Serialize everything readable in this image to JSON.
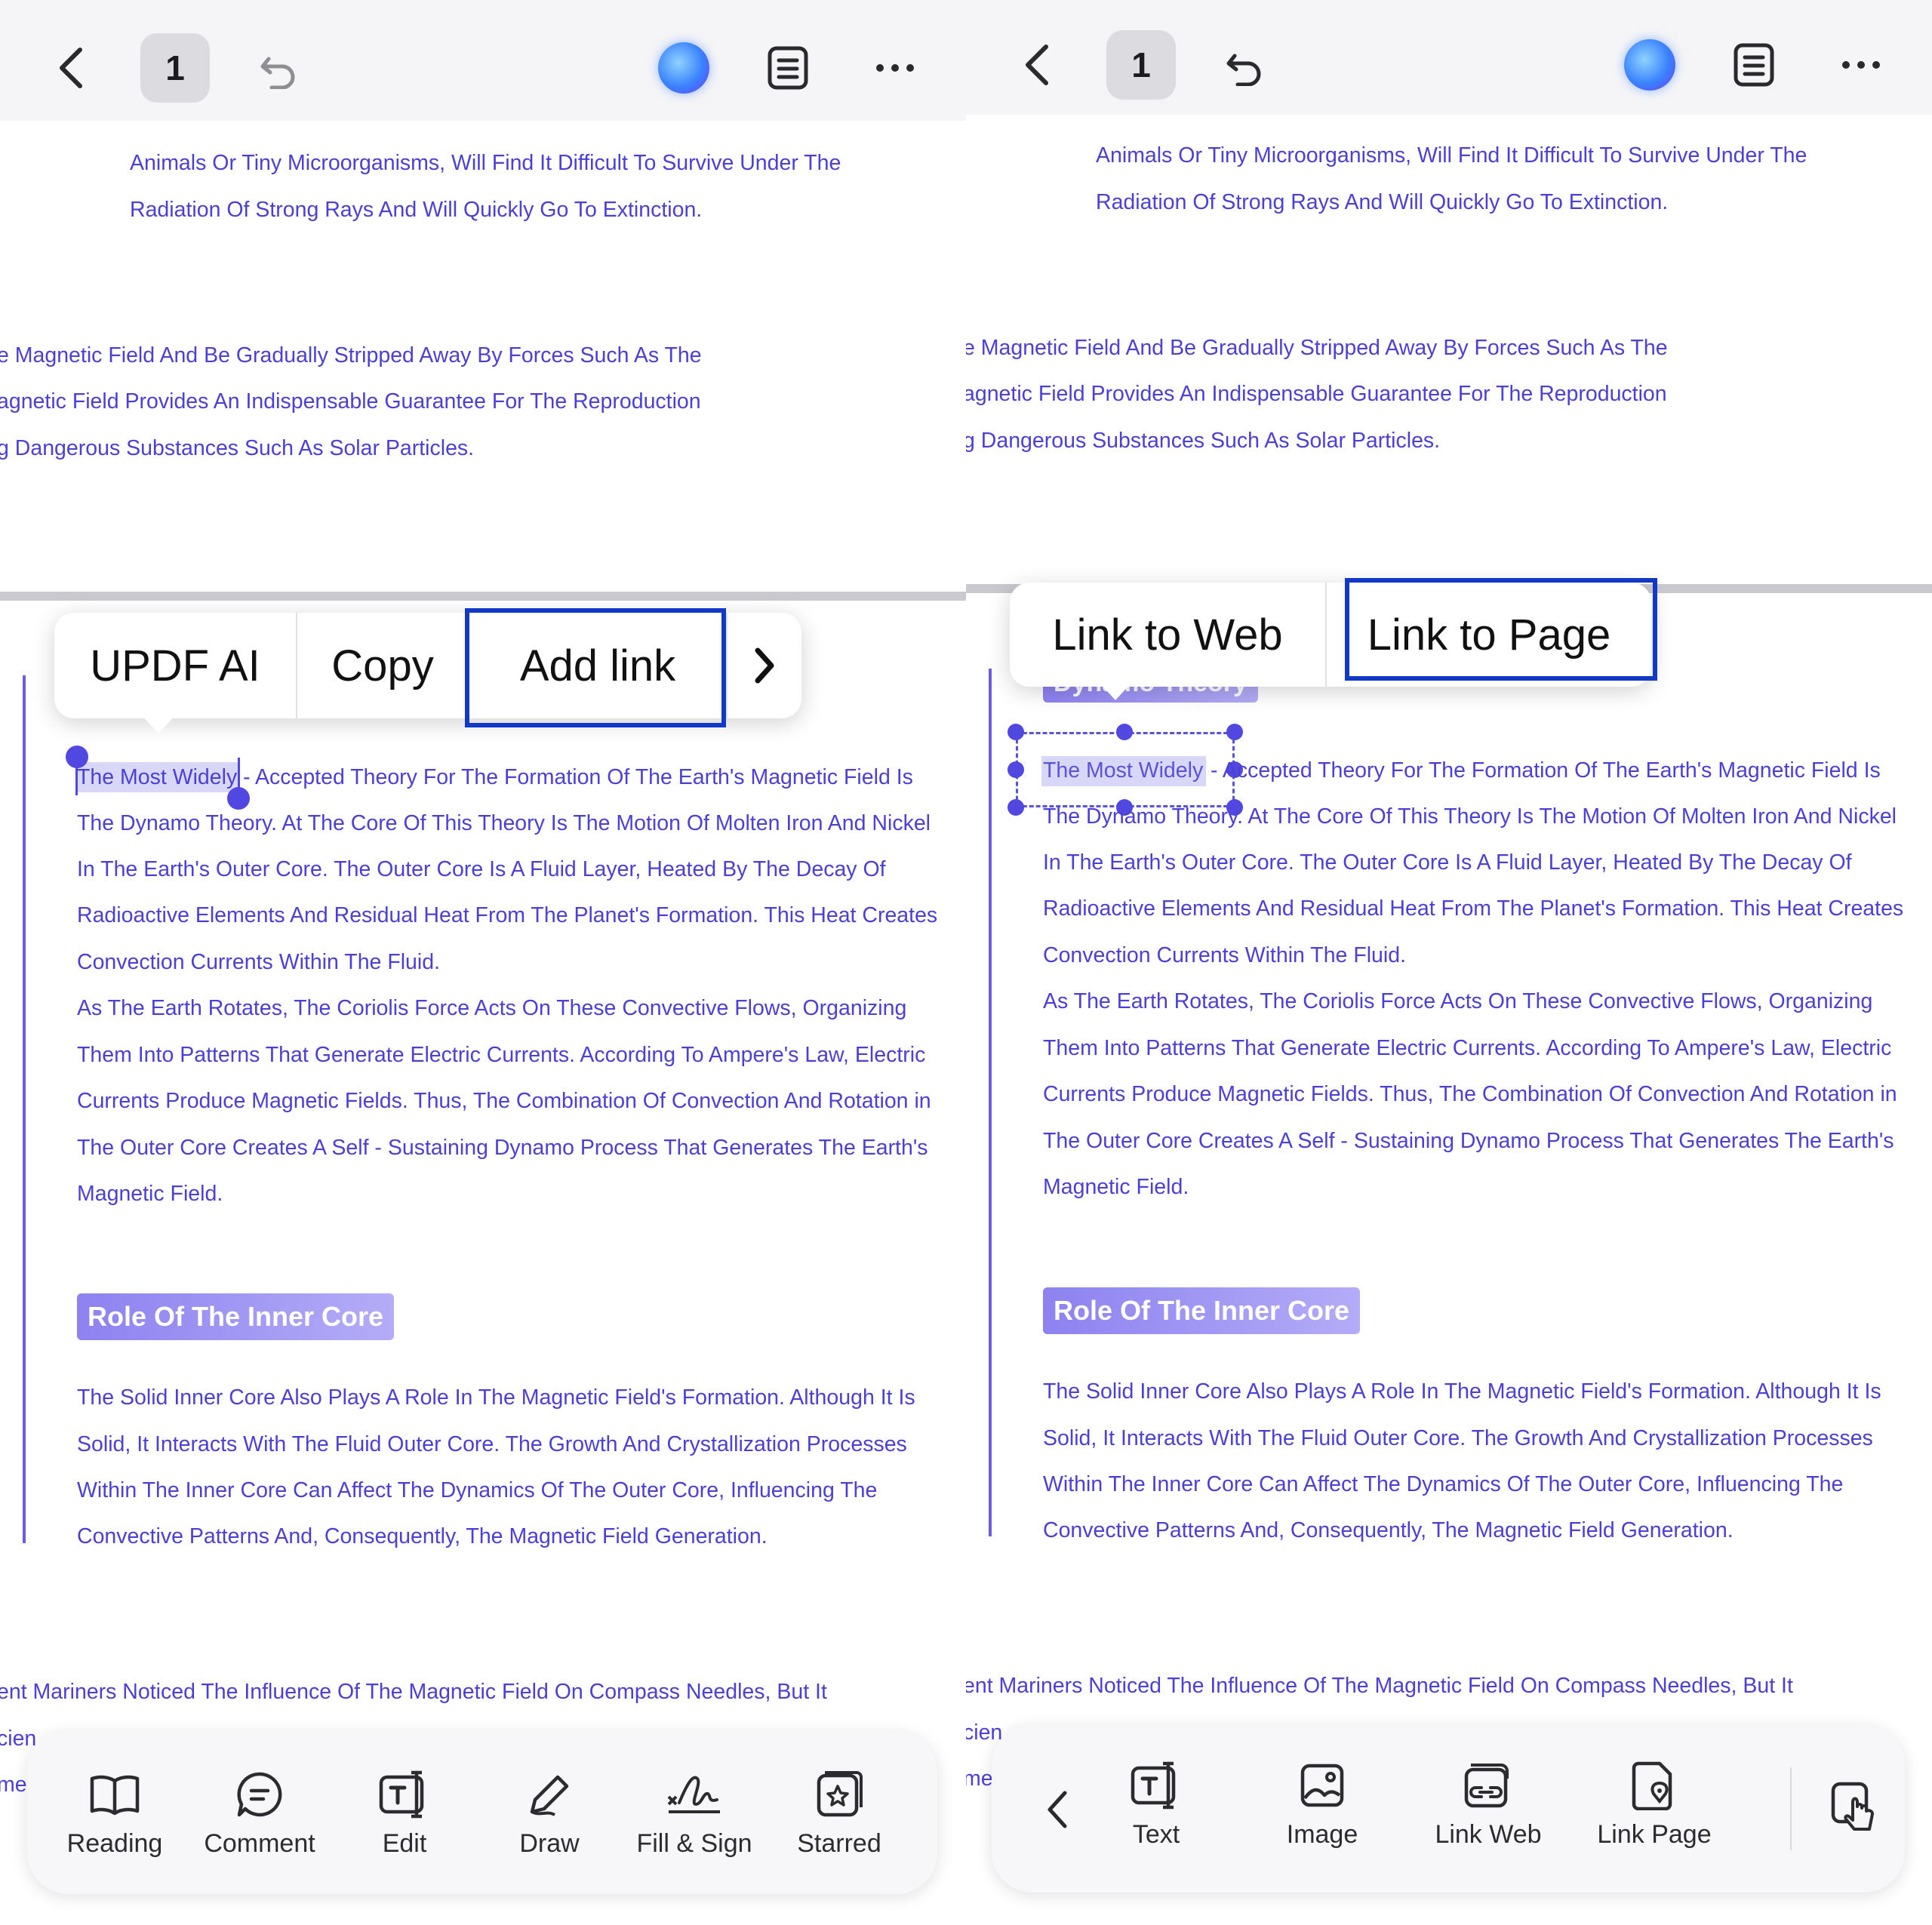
{
  "left": {
    "topbar": {
      "page_number": "1"
    },
    "context_menu": {
      "items": [
        "UPDF AI",
        "Copy",
        "Add link"
      ],
      "highlighted": "Add link",
      "more_glyph": "›"
    },
    "doc": {
      "top_lines": [
        "Animals Or Tiny Microorganisms, Will Find It Difficult To Survive Under The",
        "Radiation Of Strong Rays And Will Quickly Go To Extinction."
      ],
      "mid_lines": [
        "e Magnetic Field And Be Gradually Stripped Away By Forces Such As The",
        "agnetic Field Provides An Indispensable Guarantee For The Reproduction",
        "g Dangerous Substances Such As Solar Particles."
      ],
      "main_lines": [
        "The Most Widely - Accepted Theory For The Formation Of The Earth's Magnetic Field Is",
        "The Dynamo Theory. At The Core Of This Theory Is The Motion Of Molten Iron And Nickel",
        "In The Earth's Outer Core. The Outer Core Is A Fluid Layer, Heated By The Decay Of",
        "Radioactive Elements And Residual Heat From The Planet's Formation. This Heat Creates",
        "Convection Currents Within The Fluid.",
        "As The Earth Rotates, The Coriolis Force Acts On These Convective Flows, Organizing",
        "Them Into Patterns That Generate Electric Currents. According To Ampere's Law, Electric",
        "Currents Produce Magnetic Fields. Thus, The Combination Of Convection And Rotation in",
        "The Outer Core Creates A Self - Sustaining Dynamo Process That Generates The Earth's",
        "Magnetic Field."
      ],
      "heading2": "Role Of The Inner Core",
      "inner_lines": [
        "The Solid Inner Core Also Plays A Role In The Magnetic Field's Formation. Although It Is",
        "Solid, It Interacts With The Fluid Outer Core. The Growth And Crystallization Processes",
        "Within The Inner Core Can Affect The Dynamics Of The Outer Core, Influencing The",
        "Convective Patterns And, Consequently, The Magnetic Field Generation."
      ],
      "bottom_lines": [
        "ent Mariners Noticed The Influence Of The Magnetic Field On Compass Needles, But It",
        "cien",
        "me"
      ]
    },
    "toolbar": [
      {
        "label": "Reading",
        "icon": "book-icon"
      },
      {
        "label": "Comment",
        "icon": "comment-icon"
      },
      {
        "label": "Edit",
        "icon": "edit-text-icon"
      },
      {
        "label": "Draw",
        "icon": "pen-icon"
      },
      {
        "label": "Fill & Sign",
        "icon": "signature-icon"
      },
      {
        "label": "Starred",
        "icon": "star-icon"
      }
    ]
  },
  "right": {
    "topbar": {
      "page_number": "1"
    },
    "context_menu": {
      "items": [
        "Link to Web",
        "Link to Page"
      ],
      "highlighted": "Link to Page"
    },
    "doc": {
      "heading1": "Dynamo Theory",
      "selected_text": "The Most Widely",
      "first_line_rest": "- Accepted Theory For The Formation Of The Earth's Magnetic Field Is"
    },
    "toolbar": [
      {
        "label": "Text",
        "icon": "text-box-icon"
      },
      {
        "label": "Image",
        "icon": "image-icon"
      },
      {
        "label": "Link Web",
        "icon": "link-web-icon"
      },
      {
        "label": "Link Page",
        "icon": "link-page-icon"
      }
    ]
  },
  "colors": {
    "doc_text": "#4b3fd6",
    "highlight_border": "#1238c8",
    "heading_bg": "#9a90f2"
  }
}
